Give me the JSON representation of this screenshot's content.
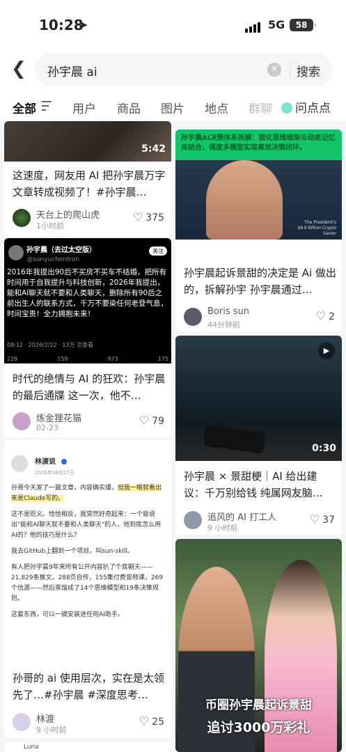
{
  "status": {
    "time": "10:28",
    "network": "5G",
    "battery": "58"
  },
  "search": {
    "query": "孙宇晨 ai",
    "button": "搜索"
  },
  "tabs": [
    "全部",
    "用户",
    "商品",
    "图片",
    "地点",
    "群聊",
    "问点点"
  ],
  "cards": [
    {
      "title": "这速度，网友用 AI 把孙宇晨万字文章转成视频了！#孙宇晨…",
      "author": "天台上的爬山虎",
      "time": "1小时前",
      "likes": "375",
      "duration": "5:42"
    },
    {
      "title": "孙宇晨起诉景甜的决定是 Ai 做出的，拆解孙宇 孙宇晨通过…",
      "author": "Boris sun",
      "time": "44分钟前",
      "likes": "2",
      "banner": "孙宇晨AI决策体系拆解：固化思维框架与动态记忆库结合，调度多模型实现高效决策闭环。",
      "photo_caption": "The President's $8.6 Billion Crypto Savior"
    },
    {
      "title": "时代的绝情与 AI 的狂欢：孙宇晨的最后通牒 这一次，他不…",
      "author": "炼金狸花猫",
      "time": "02-23",
      "likes": "79",
      "tweet": {
        "name": "孙宇晨（去过太空版）",
        "handle": "@sunyuchentron",
        "follow": "关注",
        "body": "2016年我提出90后不买房不买车不结婚，把所有时间用于自我提升与科技创新，2026年我提出，能和AI聊天就不要和人类聊天，删除所有90后之前出生人的联系方式，千万不要染任何老登气息，时间宝贵！全力拥抱未来！",
        "stamp": "08:12 · 2026/2/22 · 13万 次查看",
        "stats": [
          "229",
          "159",
          "973",
          "175"
        ]
      }
    },
    {
      "title": "孙宇晨 × 景甜梗｜AI 给出建议：千万别给钱 纯属网友脑…",
      "author": "追风的 AI 打工人",
      "time": "9 小时前",
      "likes": "37",
      "duration": "0:30"
    },
    {
      "title": "孙哥的 ai 使用层次，实在是太领先了…#孙宇晨 #深度思考…",
      "author": "林渡",
      "time": "9 小时前",
      "likes": "25",
      "doc": {
        "name": "林渡说",
        "date": "2026年08月27日",
        "p1": "孙哥今天发了一篇文章，内容确实爆，",
        "p1hl": "但我一眼就看出来是Claude写的。",
        "p2": "这不是贬义。恰恰相反，我突然好奇起来：一个能说出\"能和AI聊天就不要和人类聊天\"的人，他到底怎么用AI的？他的技巧是什么？",
        "p3": "我去GitHub上翻到一个项目，叫sun-skill。",
        "p4": "有人把孙宇晨9年来所有公开内容扒了个底朝天——21,829条推文，288页自传，155集付费音频课，269个信源——然后蒸馏成了14个思维模型和19条决策规则。",
        "p5": "这套东西，可以一键安装进任何AI助手。"
      }
    },
    {
      "caption1": "币圈孙宇晨起诉景甜",
      "caption2": "追讨3000万彩礼"
    }
  ],
  "next_author": "Luna"
}
